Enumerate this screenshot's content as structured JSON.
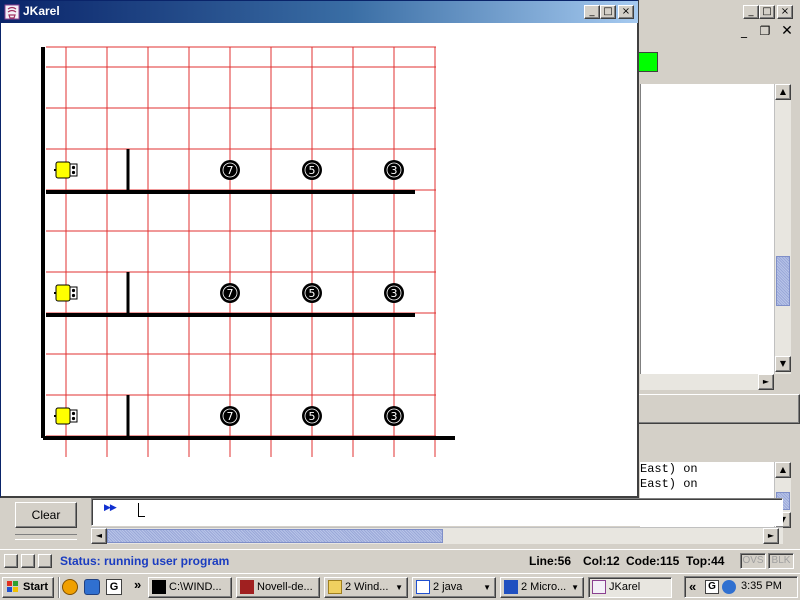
{
  "jkarel_window": {
    "title": "JKarel"
  },
  "background_console": {
    "lines": [
      "East) on",
      "East) on"
    ]
  },
  "world": {
    "rows": [
      {
        "karel": "east",
        "beepers": [
          7,
          5,
          3
        ]
      },
      {
        "karel": "east",
        "beepers": [
          7,
          5,
          3
        ]
      },
      {
        "karel": "east",
        "beepers": [
          7,
          5,
          3
        ]
      }
    ]
  },
  "controls": {
    "clear_label": "Clear",
    "prompt": "▶▶",
    "input_value": ""
  },
  "status": {
    "text": "Status: running user program",
    "line": "Line:56",
    "col": "Col:12",
    "code": "Code:115",
    "top": "Top:44",
    "ovs": "OVS",
    "blk": "BLK"
  },
  "taskbar": {
    "start_label": "Start",
    "chevron": "»",
    "items": [
      "C:\\WIND...",
      "Novell-de...",
      "2 Wind...",
      "2 java",
      "2 Micro...",
      "JKarel"
    ],
    "clock": "3:35 PM",
    "tray_chevron": "«"
  },
  "colors": {
    "grid_red": "#e03030",
    "wall_black": "#000000",
    "karel_yellow": "#ffff00",
    "status_blue": "#1a3cc0",
    "title_blue": "#0a246a",
    "status_green": "#00ff00"
  }
}
